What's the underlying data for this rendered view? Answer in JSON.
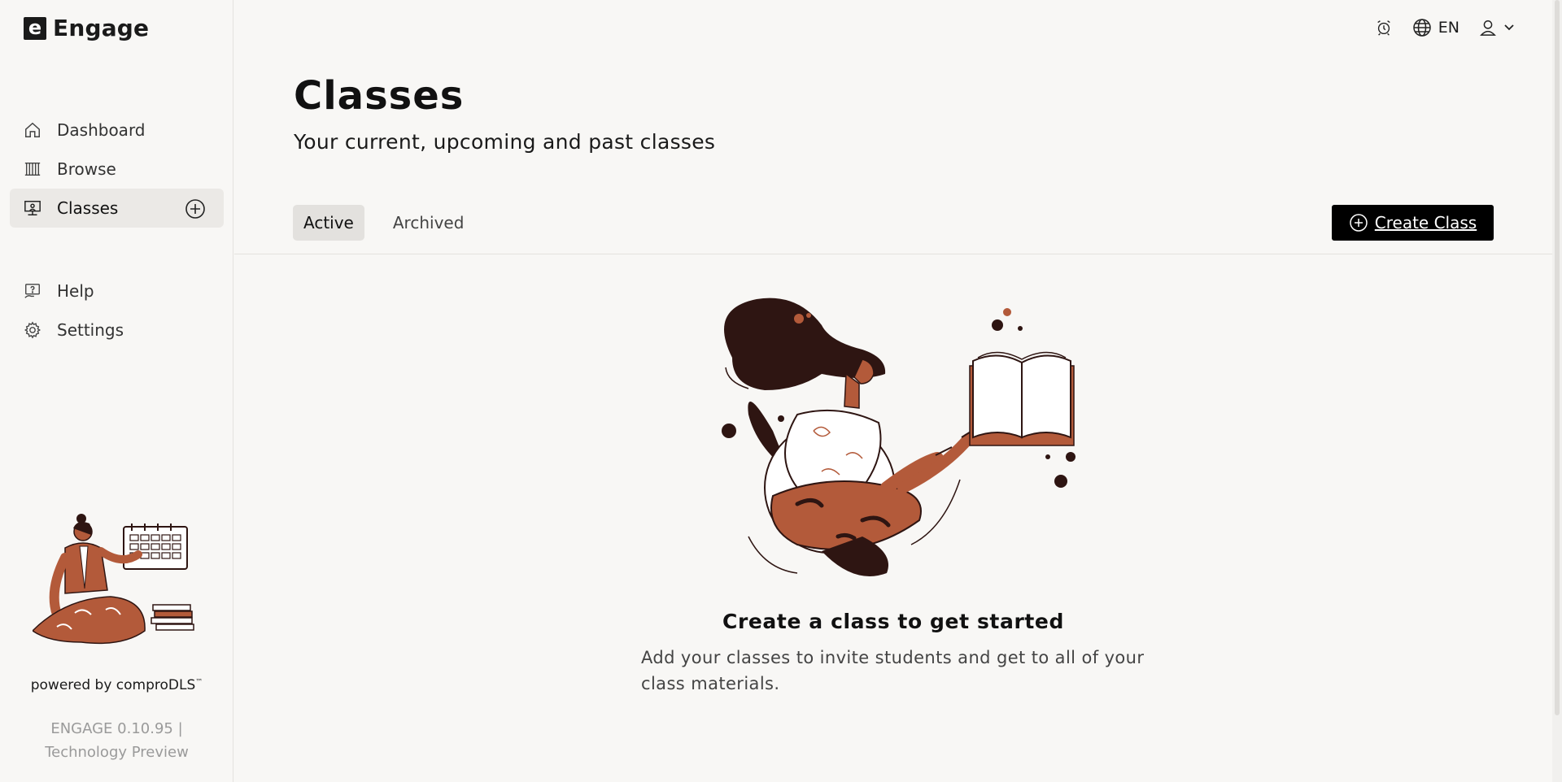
{
  "brand": {
    "logo_letter": "e",
    "name": "Engage"
  },
  "sidebar": {
    "items": [
      {
        "label": "Dashboard",
        "icon": "home-icon"
      },
      {
        "label": "Browse",
        "icon": "library-icon"
      },
      {
        "label": "Classes",
        "icon": "classroom-icon",
        "active": true
      }
    ],
    "secondary_items": [
      {
        "label": "Help",
        "icon": "help-icon"
      },
      {
        "label": "Settings",
        "icon": "gear-icon"
      }
    ],
    "powered_by": "powered by comproDLS",
    "trademark": "™",
    "version_line1": "ENGAGE 0.10.95 |",
    "version_line2": "Technology Preview"
  },
  "topbar": {
    "language": "EN"
  },
  "main": {
    "title": "Classes",
    "subtitle": "Your current, upcoming and past classes",
    "tabs": [
      {
        "label": "Active",
        "active": true
      },
      {
        "label": "Archived",
        "active": false
      }
    ],
    "create_button": "Create Class",
    "empty_title": "Create a class to get started",
    "empty_description": "Add your classes to invite students and get to all of your class materials."
  },
  "colors": {
    "accent": "#000000",
    "illustration_brown": "#b35a3a",
    "illustration_dark": "#2e1512",
    "background": "#f8f7f5"
  }
}
